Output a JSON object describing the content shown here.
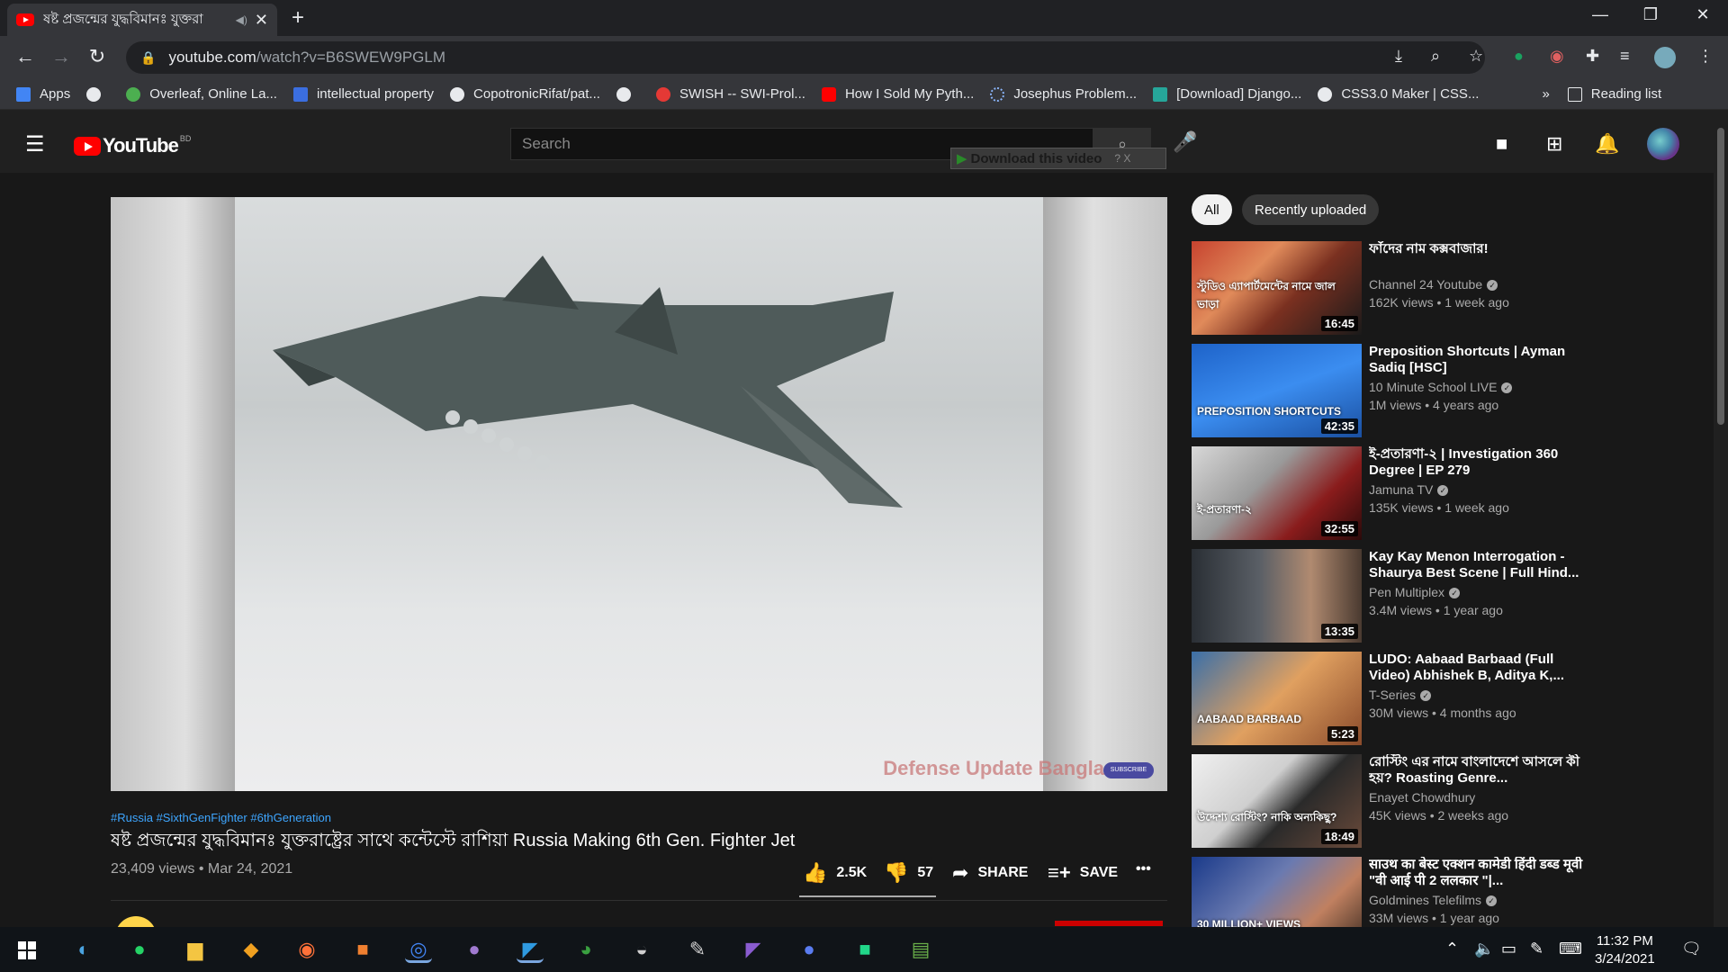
{
  "browser": {
    "tab_title": "ষষ্ট প্রজন্মের যুদ্ধবিমানঃ যুক্তরা",
    "url_host": "youtube.com",
    "url_path": "/watch?v=B6SWEW9PGLM",
    "bookmarks": [
      {
        "label": "Apps",
        "color": "#4285f4"
      },
      {
        "label": "",
        "color": "#e8eaed"
      },
      {
        "label": "Overleaf, Online La...",
        "color": "#4caf50"
      },
      {
        "label": "intellectual property",
        "color": "#3b6ee0"
      },
      {
        "label": "CopotronicRifat/pat...",
        "color": "#e8eaed"
      },
      {
        "label": "",
        "color": "#e8eaed"
      },
      {
        "label": "SWISH -- SWI-Prol...",
        "color": "#e53935"
      },
      {
        "label": "How I Sold My Pyth...",
        "color": "#ff0000"
      },
      {
        "label": "Josephus Problem...",
        "color": "#8ab4f8"
      },
      {
        "label": "[Download] Django...",
        "color": "#26a69a"
      },
      {
        "label": "CSS3.0 Maker | CSS...",
        "color": "#e8eaed"
      }
    ],
    "reading_list": "Reading list"
  },
  "youtube": {
    "logo_text": "YouTube",
    "country_code": "BD",
    "search_placeholder": "Search",
    "download_bar": "Download this video",
    "download_bar_extra": "? X"
  },
  "video": {
    "watermark": "Defense Update Bangla",
    "subscribe_badge": "SUBSCRIBE",
    "hashtags": "#Russia #SixthGenFighter #6thGeneration",
    "title": "ষষ্ট প্রজন্মের যুদ্ধবিমানঃ যুক্তরাষ্ট্রের সাথে কন্টেস্টে রাশিয়া Russia Making 6th Gen. Fighter Jet",
    "views_date": "23,409 views • Mar 24, 2021",
    "likes": "2.5K",
    "dislikes": "57",
    "share_label": "SHARE",
    "save_label": "SAVE"
  },
  "sidebar": {
    "chips": [
      "All",
      "Recently uploaded"
    ],
    "recommendations": [
      {
        "title": "ফাঁদের নাম কক্সবাজার!",
        "channel": "Channel 24 Youtube",
        "verified": true,
        "meta": "162K views • 1 week ago",
        "duration": "16:45",
        "thumb": "linear-gradient(135deg,#c7432f 0%,#e08a5a 35%,#7a3020 60%,#1a1a1a 100%)",
        "thumb_text": "স্টুডিও এ্যাপার্টমেন্টের নামে জাল ভাড়া"
      },
      {
        "title": "Preposition Shortcuts | Ayman Sadiq [HSC]",
        "channel": "10 Minute School LIVE",
        "verified": true,
        "meta": "1M views • 4 years ago",
        "duration": "42:35",
        "thumb": "linear-gradient(160deg,#1e63c9 0%,#3b8df0 50%,#1a4fa0 100%)",
        "thumb_text": "PREPOSITION SHORTCUTS"
      },
      {
        "title": "ই-প্রতারণা-২ | Investigation 360 Degree | EP 279",
        "channel": "Jamuna TV",
        "verified": true,
        "meta": "135K views • 1 week ago",
        "duration": "32:55",
        "thumb": "linear-gradient(135deg,#d8d8d8 0%,#9a9a9a 40%,#8a1c1c 70%,#2a0a0a 100%)",
        "thumb_text": "ই-প্রতারণা-২"
      },
      {
        "title": "Kay Kay Menon Interrogation - Shaurya Best Scene | Full Hind...",
        "channel": "Pen Multiplex",
        "verified": true,
        "meta": "3.4M views • 1 year ago",
        "duration": "13:35",
        "thumb": "linear-gradient(90deg,#2a2f35 0%,#5a5f66 40%,#b08a70 70%,#4a3a30 100%)",
        "thumb_text": ""
      },
      {
        "title": "LUDO: Aabaad Barbaad (Full Video) Abhishek B, Aditya K,...",
        "channel": "T-Series",
        "verified": true,
        "meta": "30M views • 4 months ago",
        "duration": "5:23",
        "thumb": "linear-gradient(135deg,#3a6fa8 0%,#e0a060 50%,#8a4a2a 100%)",
        "thumb_text": "AABAAD BARBAAD"
      },
      {
        "title": "রোস্টিং এর নামে বাংলাদেশে আসলে কী হয়? Roasting Genre...",
        "channel": "Enayet Chowdhury",
        "verified": false,
        "meta": "45K views • 2 weeks ago",
        "duration": "18:49",
        "thumb": "linear-gradient(135deg,#f0f0f0 0%,#cfcfcf 40%,#2a2a2a 60%,#6a4a3a 100%)",
        "thumb_text": "উদ্দেশ্য রোস্টিং? নাকি অন্যকিছু?"
      },
      {
        "title": "साउथ का बेस्ट एक्शन कामेडी हिंदी डब्ड मूवी \"वी आई पी 2 ललकार \"|...",
        "channel": "Goldmines Telefilms",
        "verified": true,
        "meta": "33M views • 1 year ago",
        "duration": "",
        "thumb": "linear-gradient(135deg,#1a3a8a 0%,#6a7ab0 40%,#c08060 70%,#3a2a20 100%)",
        "thumb_text": "30 MILLION+ VIEWS"
      }
    ]
  },
  "taskbar": {
    "time": "11:32 PM",
    "date": "3/24/2021"
  }
}
